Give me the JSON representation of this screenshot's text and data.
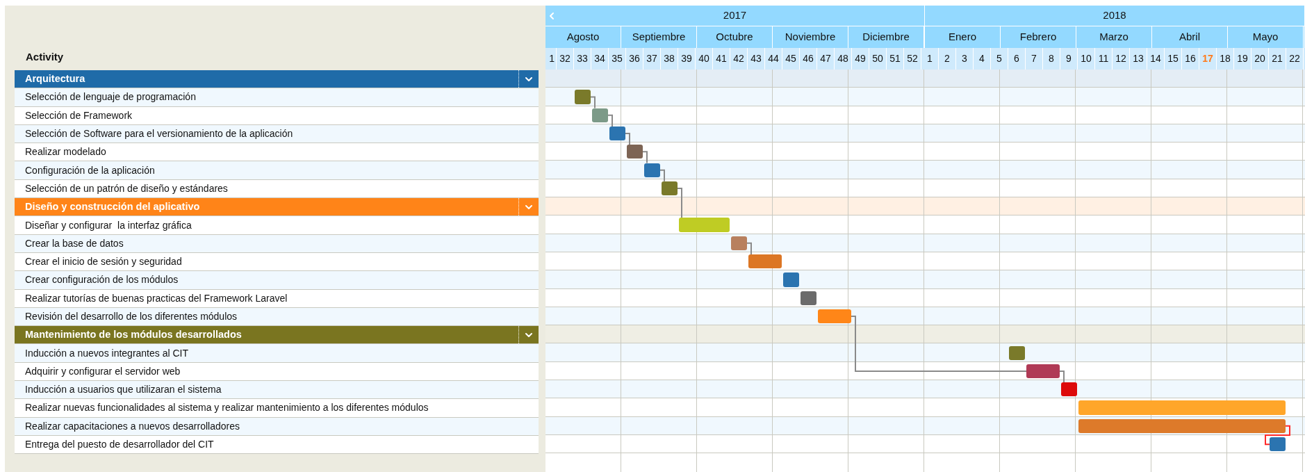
{
  "activity_header": "Activity",
  "timeline": {
    "years": [
      {
        "label": "2017",
        "months": [
          "Agosto",
          "Septiembre",
          "Octubre",
          "Noviembre",
          "Diciembre"
        ]
      },
      {
        "label": "2018",
        "months": [
          "Enero",
          "Febrero",
          "Marzo",
          "Abril",
          "Mayo"
        ]
      }
    ],
    "weeks": [
      {
        "label": "1",
        "current": false
      },
      {
        "label": "32",
        "current": false
      },
      {
        "label": "33",
        "current": false
      },
      {
        "label": "34",
        "current": false
      },
      {
        "label": "35",
        "current": false
      },
      {
        "label": "36",
        "current": false
      },
      {
        "label": "37",
        "current": false
      },
      {
        "label": "38",
        "current": false
      },
      {
        "label": "39",
        "current": false
      },
      {
        "label": "40",
        "current": false
      },
      {
        "label": "41",
        "current": false
      },
      {
        "label": "42",
        "current": false
      },
      {
        "label": "43",
        "current": false
      },
      {
        "label": "44",
        "current": false
      },
      {
        "label": "45",
        "current": false
      },
      {
        "label": "46",
        "current": false
      },
      {
        "label": "47",
        "current": false
      },
      {
        "label": "48",
        "current": false
      },
      {
        "label": "49",
        "current": false
      },
      {
        "label": "50",
        "current": false
      },
      {
        "label": "51",
        "current": false
      },
      {
        "label": "52",
        "current": false
      },
      {
        "label": "1",
        "current": false
      },
      {
        "label": "2",
        "current": false
      },
      {
        "label": "3",
        "current": false
      },
      {
        "label": "4",
        "current": false
      },
      {
        "label": "5",
        "current": false
      },
      {
        "label": "6",
        "current": false
      },
      {
        "label": "7",
        "current": false
      },
      {
        "label": "8",
        "current": false
      },
      {
        "label": "9",
        "current": false
      },
      {
        "label": "10",
        "current": false
      },
      {
        "label": "11",
        "current": false
      },
      {
        "label": "12",
        "current": false
      },
      {
        "label": "13",
        "current": false
      },
      {
        "label": "14",
        "current": false
      },
      {
        "label": "15",
        "current": false
      },
      {
        "label": "16",
        "current": false
      },
      {
        "label": "17",
        "current": true
      },
      {
        "label": "18",
        "current": false
      },
      {
        "label": "19",
        "current": false
      },
      {
        "label": "20",
        "current": false
      },
      {
        "label": "21",
        "current": false
      },
      {
        "label": "22",
        "current": false
      }
    ]
  },
  "groups": [
    {
      "name": "Arquitectura",
      "color": "#1f6ba8",
      "expanded": true,
      "tasks": [
        {
          "name": "Selección de lenguaje de programación",
          "color": "#7a7a2a",
          "kind": "plain"
        },
        {
          "name": "Selección de Framework",
          "color": "#7c9a88",
          "kind": "linked"
        },
        {
          "name": "Selección de Software para el versionamiento de la aplicación",
          "color": "#2b74b0",
          "kind": "linked"
        },
        {
          "name": "Realizar modelado",
          "color": "#7d6454",
          "kind": "linked"
        },
        {
          "name": "Configuración de la aplicación",
          "color": "#2b74b0",
          "kind": "linked"
        },
        {
          "name": "Selección de un patrón de diseño y estándares",
          "color": "#7a7a2a",
          "kind": "linked"
        }
      ]
    },
    {
      "name": "Diseño y construcción del aplicativo",
      "color": "#ff8418",
      "expanded": true,
      "tasks": [
        {
          "name": "Diseñar y configurar  la interfaz gráfica",
          "color": "#bfcc24",
          "kind": "linked"
        },
        {
          "name": "Crear la base de datos",
          "color": "#b8805e",
          "kind": "plain"
        },
        {
          "name": "Crear el inicio de sesión y seguridad",
          "color": "#dc7624",
          "kind": "linked"
        },
        {
          "name": "Crear configuración de los módulos",
          "color": "#2b74b0",
          "kind": "plain"
        },
        {
          "name": "Realizar tutorías de buenas practicas del Framework Laravel",
          "color": "#6b6b6b",
          "kind": "plain"
        },
        {
          "name": "Revisión del desarrollo de los diferentes módulos",
          "color": "#ff8618",
          "kind": "plain"
        }
      ]
    },
    {
      "name": "Mantenimiento de los módulos desarrollados",
      "color": "#7a7520",
      "expanded": true,
      "tasks": [
        {
          "name": "Inducción a nuevos integrantes al CIT",
          "color": "#7a7a2a",
          "kind": "plain"
        },
        {
          "name": "Adquirir y configurar el servidor web",
          "color": "#b03a55",
          "kind": "linked-across"
        },
        {
          "name": "Inducción a usuarios que utilizaran el sistema",
          "color": "#dd0a0a",
          "kind": "linked"
        },
        {
          "name": "Realizar nuevas funcionalidades al sistema y realizar mantenimiento a los diferentes módulos",
          "color": "#ffa62a",
          "kind": "plain"
        },
        {
          "name": "Realizar capacitaciones a nuevos desarrolladores",
          "color": "#dd7a2a",
          "kind": "plain"
        },
        {
          "name": "Entrega del puesto de desarrollador del CIT",
          "color": "#2b74b0",
          "kind": "critical"
        }
      ]
    }
  ]
}
